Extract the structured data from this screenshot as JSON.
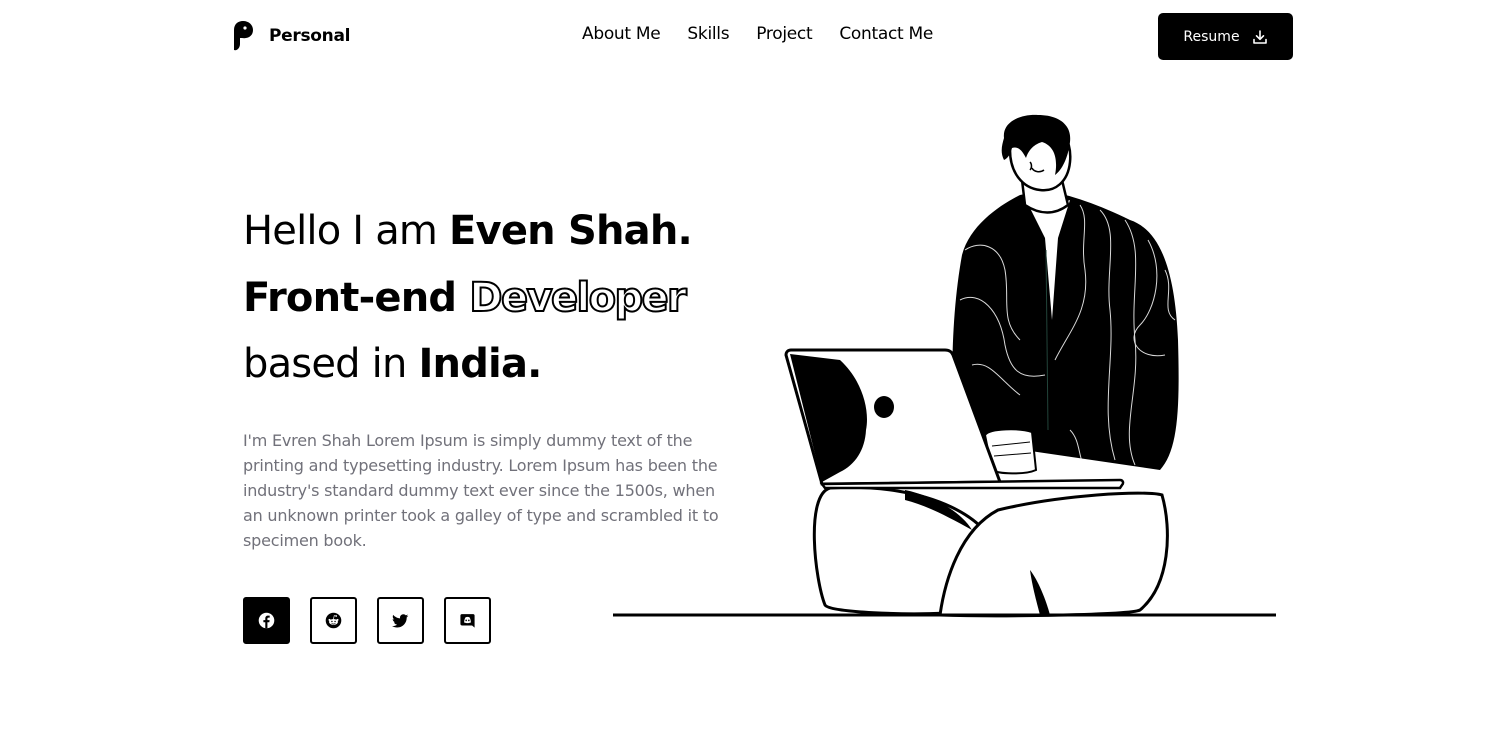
{
  "header": {
    "logo_text": "Personal",
    "nav": [
      {
        "label": "About Me"
      },
      {
        "label": "Skills"
      },
      {
        "label": "Project"
      },
      {
        "label": "Contact Me"
      }
    ],
    "resume_label": "Resume"
  },
  "hero": {
    "line1_prefix": "Hello I am ",
    "line1_name": "Even Shah.",
    "line2_bold": "Front-end ",
    "line2_outlined": "Developer",
    "line3_prefix": "based in ",
    "line3_place": "India.",
    "description": "I'm Evren Shah Lorem Ipsum is simply dummy text of the printing and typesetting industry. Lorem Ipsum has been the industry's standard dummy text ever since the 1500s, when an unknown printer took a galley of type and scrambled it to specimen book."
  },
  "socials": [
    {
      "icon": "facebook-icon",
      "active": true
    },
    {
      "icon": "reddit-icon",
      "active": false
    },
    {
      "icon": "twitter-icon",
      "active": false
    },
    {
      "icon": "discord-icon",
      "active": false
    }
  ],
  "colors": {
    "primary": "#000000",
    "background": "#ffffff",
    "muted_text": "#71717a"
  }
}
